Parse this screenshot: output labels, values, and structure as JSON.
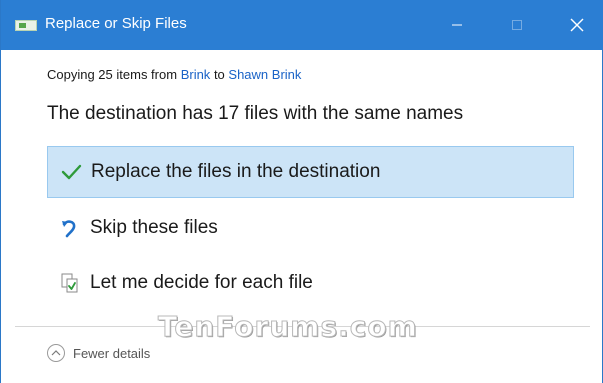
{
  "window": {
    "title": "Replace or Skip Files",
    "title_bar_color": "#2b7ed3",
    "controls": {
      "minimize": "minimize-icon",
      "maximize": "maximize-icon",
      "close": "close-icon"
    }
  },
  "copying": {
    "prefix": "Copying 25 items from",
    "source": "Brink",
    "middle": "to",
    "destination": "Shawn Brink"
  },
  "heading": "The destination has 17 files with the same names",
  "options": [
    {
      "icon": "checkmark-icon",
      "label": "Replace the files in the destination",
      "selected": true
    },
    {
      "icon": "skip-arrow-icon",
      "label": "Skip these files",
      "selected": false
    },
    {
      "icon": "compare-files-icon",
      "label": "Let me decide for each file",
      "selected": false
    }
  ],
  "details_toggle": {
    "icon": "chevron-up-icon",
    "label": "Fewer details"
  },
  "watermark": "TenForums.com",
  "colors": {
    "accent": "#2b7ed3",
    "link": "#1a63c7",
    "selection_bg": "#cce4f7",
    "selection_border": "#99c9ef"
  }
}
